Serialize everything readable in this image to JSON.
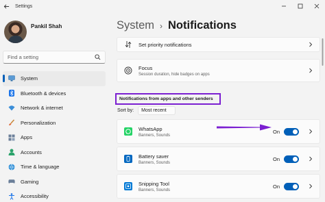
{
  "window": {
    "title": "Settings",
    "back_icon": "back-arrow-icon",
    "controls": [
      "minimize-icon",
      "maximize-icon",
      "close-icon"
    ]
  },
  "profile": {
    "name": "Pankil Shah"
  },
  "search": {
    "placeholder": "Find a setting",
    "icon": "search-icon"
  },
  "sidebar": {
    "items": [
      {
        "label": "System",
        "icon": "system-icon",
        "active": true
      },
      {
        "label": "Bluetooth & devices",
        "icon": "bluetooth-icon"
      },
      {
        "label": "Network & internet",
        "icon": "wifi-icon"
      },
      {
        "label": "Personalization",
        "icon": "brush-icon"
      },
      {
        "label": "Apps",
        "icon": "apps-icon"
      },
      {
        "label": "Accounts",
        "icon": "account-icon"
      },
      {
        "label": "Time & language",
        "icon": "globe-icon"
      },
      {
        "label": "Gaming",
        "icon": "gaming-icon"
      },
      {
        "label": "Accessibility",
        "icon": "accessibility-icon"
      }
    ]
  },
  "breadcrumb": {
    "parent": "System",
    "separator": "›",
    "current": "Notifications"
  },
  "top_cards": [
    {
      "title": "Set priority notifications",
      "icon": "priority-icon"
    },
    {
      "title": "Focus",
      "subtitle": "Session duration, hide badges on apps",
      "icon": "focus-icon"
    }
  ],
  "section": {
    "title": "Notifications from apps and other senders"
  },
  "sort": {
    "label": "Sort by:",
    "value": "Most recent"
  },
  "apps": [
    {
      "name": "WhatsApp",
      "subtitle": "Banners, Sounds",
      "state": "On",
      "enabled": true,
      "icon": "whatsapp-icon",
      "icon_color": "#25d366"
    },
    {
      "name": "Battery saver",
      "subtitle": "Banners, Sounds",
      "state": "On",
      "enabled": true,
      "icon": "battery-saver-icon",
      "icon_color": "#0067c0"
    },
    {
      "name": "Snipping Tool",
      "subtitle": "Banners, Sounds",
      "state": "On",
      "enabled": true,
      "icon": "snipping-tool-icon",
      "icon_color": "#0078d4"
    }
  ],
  "colors": {
    "accent": "#005fb8",
    "highlight_border": "#7b1fd1",
    "arrow": "#7b1fd1"
  }
}
